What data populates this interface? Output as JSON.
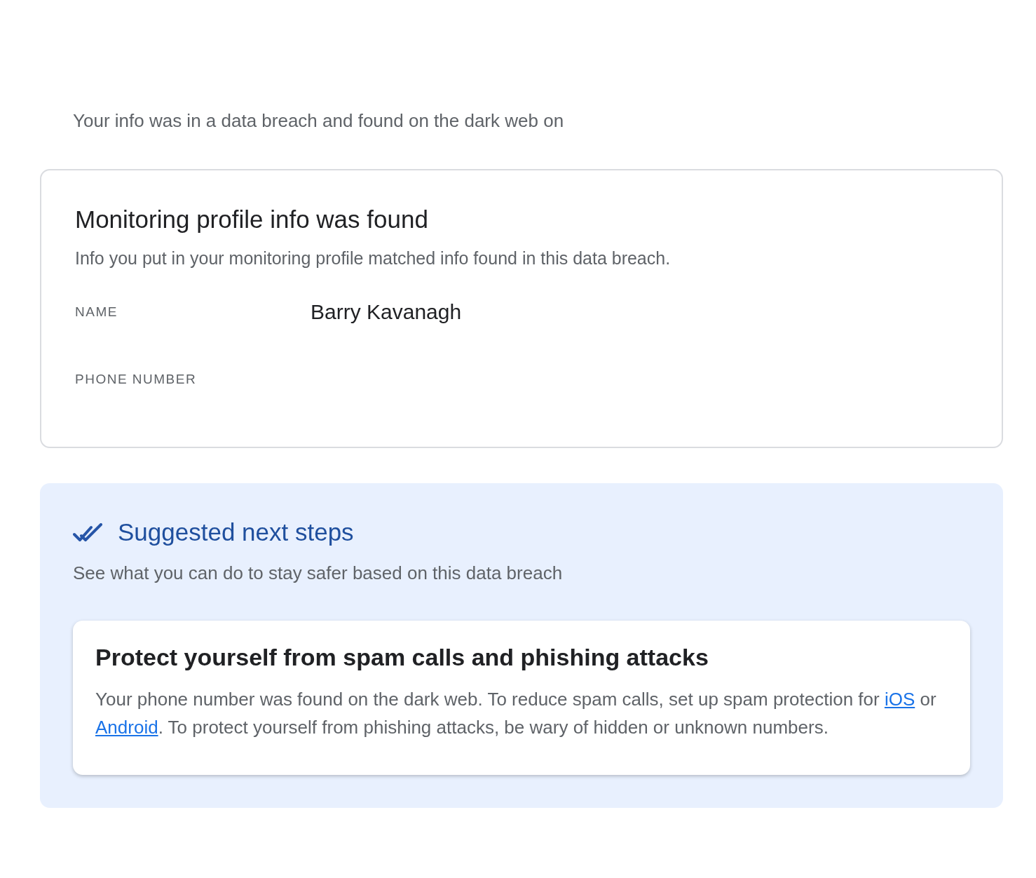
{
  "intro": "Your info was in a data breach and found on the dark web on",
  "profile_card": {
    "title": "Monitoring profile info was found",
    "description": "Info you put in your monitoring profile matched info found in this data breach.",
    "fields": [
      {
        "label": "NAME",
        "value": "Barry Kavanagh"
      },
      {
        "label": "PHONE NUMBER"
      }
    ]
  },
  "next_steps": {
    "title": "Suggested next steps",
    "description": "See what you can do to stay safer based on this data breach",
    "tips": [
      {
        "title": "Protect yourself from spam calls and phishing attacks",
        "body": [
          {
            "kind": "text",
            "text": "Your phone number was found on the dark web. To reduce spam calls, set up spam protection for "
          },
          {
            "kind": "link",
            "text": "iOS"
          },
          {
            "kind": "text",
            "text": " or "
          },
          {
            "kind": "link",
            "text": "Android"
          },
          {
            "kind": "text",
            "text": ". To protect yourself from phishing attacks, be wary of hidden or unknown numbers."
          }
        ]
      }
    ]
  }
}
